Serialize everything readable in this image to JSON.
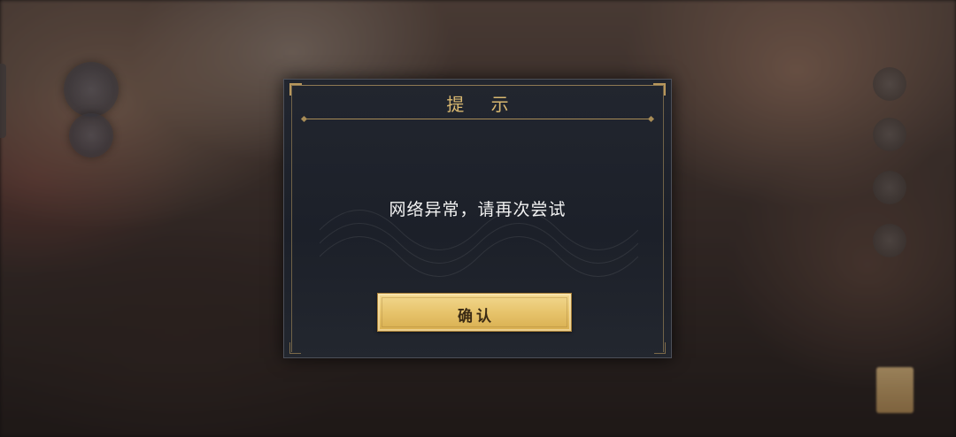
{
  "dialog": {
    "title": "提 示",
    "message": "网络异常，请再次尝试",
    "confirm_label": "确认"
  },
  "colors": {
    "dialog_bg": "#1e222b",
    "title_gold": "#d9b870",
    "button_gold": "#e7c46c",
    "message_text": "#f2f2f2"
  },
  "icons": {
    "left_buttons": [
      "round-menu-icon",
      "round-menu-icon"
    ],
    "right_buttons": [
      "side-icon",
      "side-icon",
      "side-icon",
      "side-icon"
    ]
  }
}
